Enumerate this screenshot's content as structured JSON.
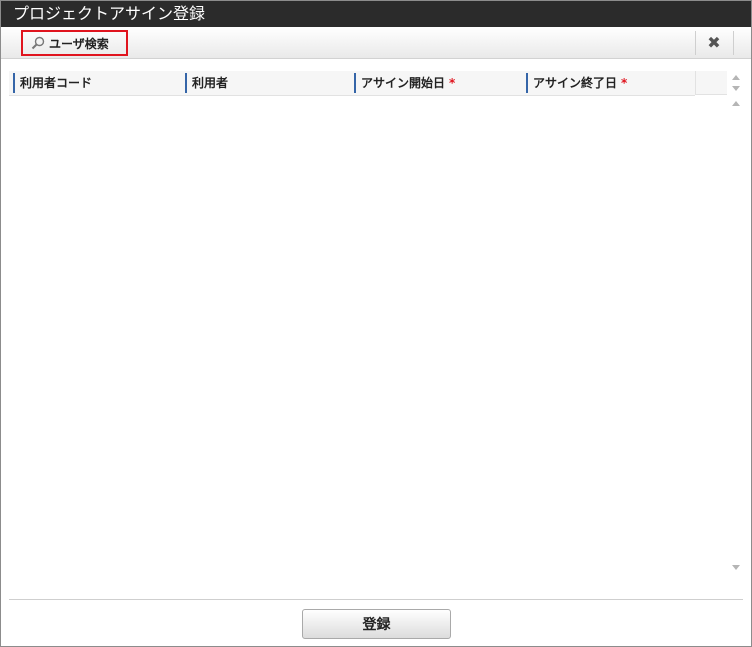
{
  "dialog": {
    "title": "プロジェクトアサイン登録"
  },
  "toolbar": {
    "search_button_label": "ユーザ検索",
    "search_icon": "search-icon",
    "close_icon": "close-icon",
    "close_glyph": "✖",
    "highlight_color": "#e0141e"
  },
  "grid": {
    "columns": [
      {
        "label": "利用者コード",
        "required": false
      },
      {
        "label": "利用者",
        "required": false
      },
      {
        "label": "アサイン開始日",
        "required": true
      },
      {
        "label": "アサイン終了日",
        "required": true
      }
    ],
    "required_mark": "*",
    "rows": []
  },
  "footer": {
    "submit_label": "登録"
  }
}
